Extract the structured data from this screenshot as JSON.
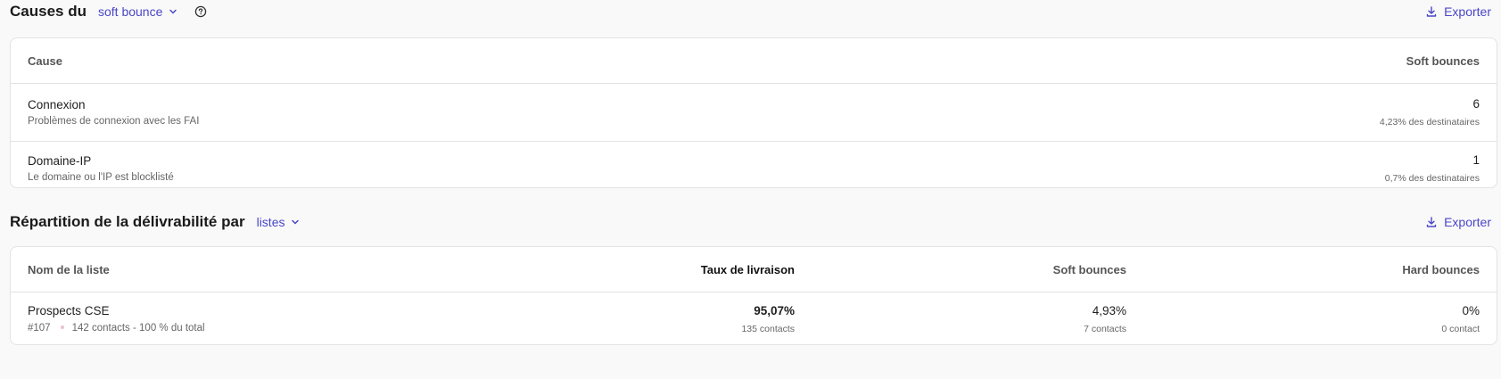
{
  "causes": {
    "title": "Causes du",
    "dropdown_label": "soft bounce",
    "export_label": "Exporter",
    "table": {
      "col_cause": "Cause",
      "col_count": "Soft bounces",
      "rows": [
        {
          "name": "Connexion",
          "desc": "Problèmes de connexion avec les FAI",
          "count": "6",
          "pct": "4,23% des destinataires"
        },
        {
          "name": "Domaine-IP",
          "desc": "Le domaine ou l'IP est blocklisté",
          "count": "1",
          "pct": "0,7% des destinataires"
        }
      ]
    }
  },
  "repartition": {
    "title": "Répartition de la délivrabilité par",
    "dropdown_label": "listes",
    "export_label": "Exporter",
    "table": {
      "col_name": "Nom de la liste",
      "col_taux": "Taux de livraison",
      "col_soft": "Soft bounces",
      "col_hard": "Hard bounces",
      "rows": [
        {
          "name": "Prospects CSE",
          "id": "#107",
          "contacts_info": "142 contacts - 100 % du total",
          "taux": "95,07%",
          "taux_sub": "135 contacts",
          "soft": "4,93%",
          "soft_sub": "7 contacts",
          "hard": "0%",
          "hard_sub": "0 contact"
        }
      ]
    }
  },
  "colors": {
    "accent": "#4a46c8",
    "border": "#e3e3e3",
    "background": "#f9f9f9"
  }
}
